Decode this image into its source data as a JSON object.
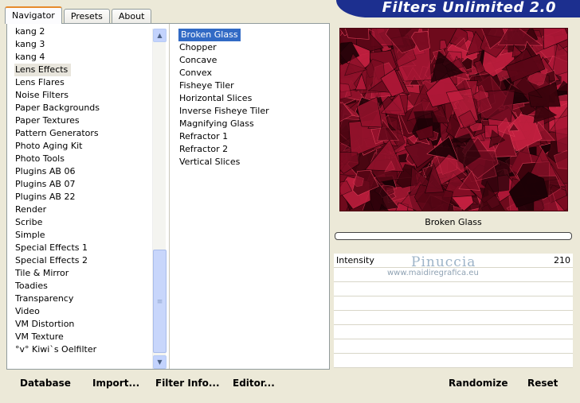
{
  "tabs": [
    "Navigator",
    "Presets",
    "About"
  ],
  "brand": "Filters Unlimited 2.0",
  "categories": [
    "kang 2",
    "kang 3",
    "kang 4",
    "Lens Effects",
    "Lens Flares",
    "Noise Filters",
    "Paper Backgrounds",
    "Paper Textures",
    "Pattern Generators",
    "Photo Aging Kit",
    "Photo Tools",
    "Plugins AB 06",
    "Plugins AB 07",
    "Plugins AB 22",
    "Render",
    "Scribe",
    "Simple",
    "Special Effects 1",
    "Special Effects 2",
    "Tile & Mirror",
    "Toadies",
    "Transparency",
    "Video",
    "VM Distortion",
    "VM Texture",
    "°v° Kiwi`s Oelfilter"
  ],
  "selected_category": "Lens Effects",
  "filters": [
    "Broken Glass",
    "Chopper",
    "Concave",
    "Convex",
    "Fisheye Tiler",
    "Horizontal Slices",
    "Inverse Fisheye Tiler",
    "Magnifying Glass",
    "Refractor 1",
    "Refractor 2",
    "Vertical Slices"
  ],
  "selected_filter": "Broken Glass",
  "preview_label": "Broken Glass",
  "param": {
    "name": "Intensity",
    "value": "210"
  },
  "watermark": {
    "line1": "Pinuccia",
    "line2": "www.maidiregrafica.eu"
  },
  "buttons": {
    "database": "Database",
    "import": "Import...",
    "filter_info": "Filter Info...",
    "editor": "Editor...",
    "randomize": "Randomize",
    "reset": "Reset"
  },
  "colors": {
    "accent": "#316ac5",
    "brand_bg": "#1c2f8f",
    "preview_base": "#6e0a1c"
  }
}
